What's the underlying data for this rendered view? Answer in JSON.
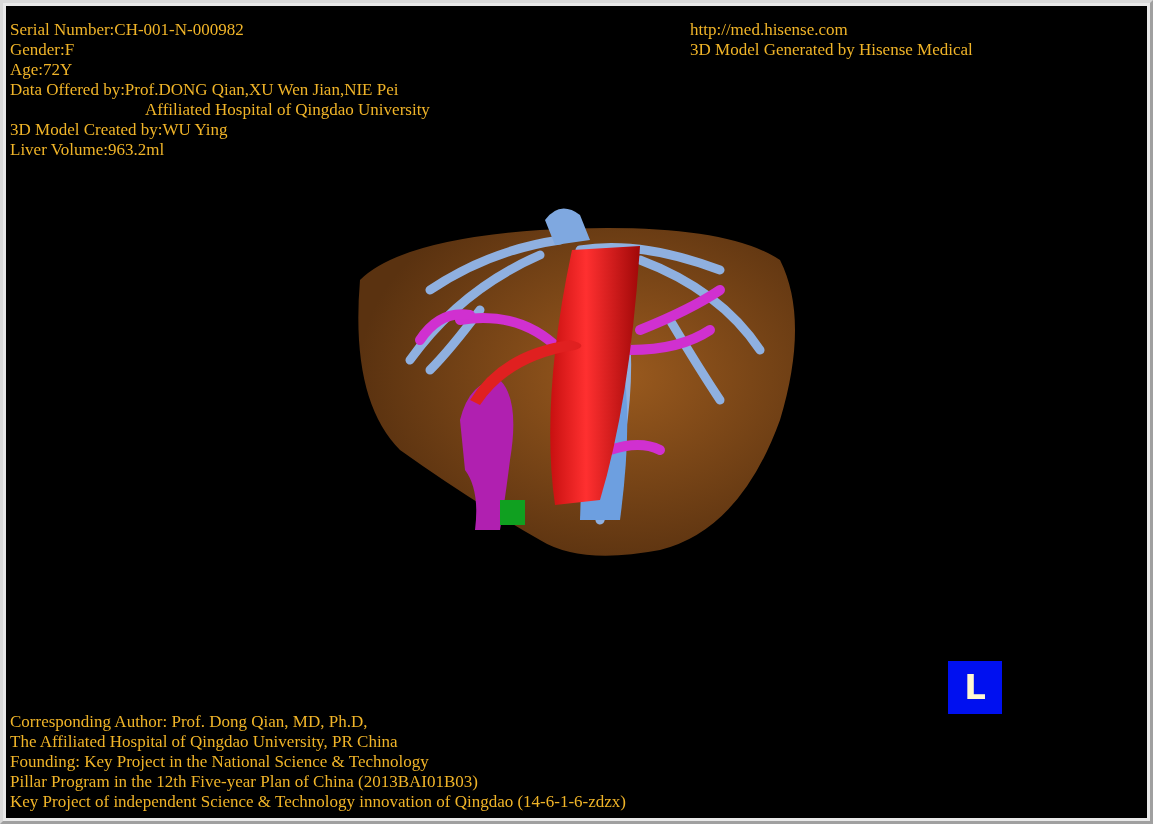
{
  "patient_info": [
    {
      "kind": "line",
      "text": "Serial Number:CH-001-N-000982"
    },
    {
      "kind": "line",
      "text": "Gender:F"
    },
    {
      "kind": "line",
      "text": "Age:72Y"
    },
    {
      "kind": "line",
      "text": "Data Offered by:Prof.DONG Qian,XU Wen Jian,NIE Pei"
    },
    {
      "kind": "continuation",
      "text": "Affiliated Hospital of Qingdao University"
    },
    {
      "kind": "line",
      "text": "3D Model Created by:WU Ying"
    },
    {
      "kind": "line",
      "text": "Liver Volume:963.2ml"
    }
  ],
  "vendor_info": [
    "http://med.hisense.com",
    "3D Model Generated by Hisense Medical"
  ],
  "orientation_marker": {
    "label": "L"
  },
  "credits": [
    "Corresponding Author: Prof. Dong Qian, MD, Ph.D,",
    "The Affiliated Hospital of Qingdao University, PR China",
    "Founding: Key Project in the National Science & Technology",
    "Pillar Program in the 12th Five-year Plan of China (2013BAI01B03)",
    "Key Project of independent Science & Technology innovation of Qingdao (14-6-1-6-zdzx)"
  ]
}
